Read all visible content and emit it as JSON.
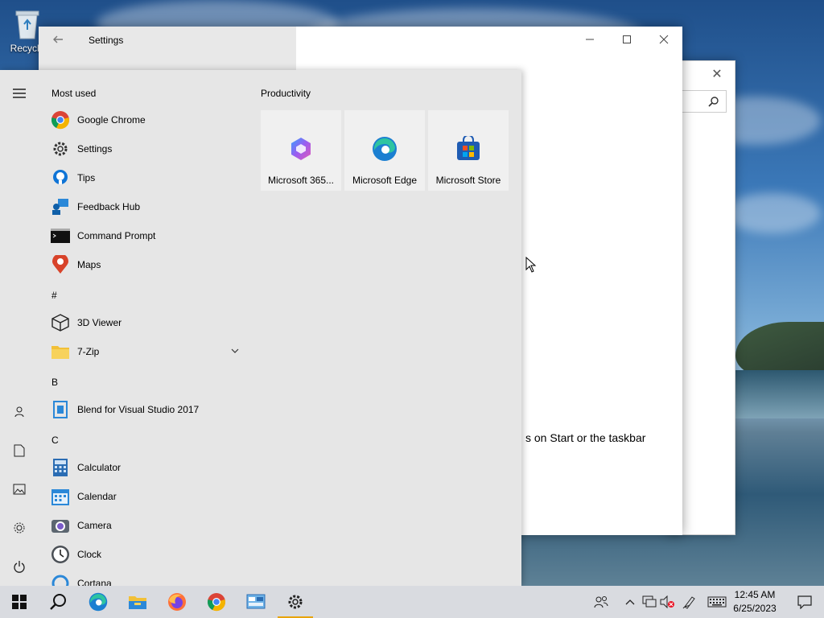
{
  "desktop": {
    "recycle_bin_label": "Recycle"
  },
  "back_window": {
    "close_icon": "close-icon",
    "search_icon": "search-icon"
  },
  "settings_window": {
    "title": "Settings",
    "partial_text": "s on Start or the taskbar",
    "controls": [
      "minimize",
      "maximize",
      "close"
    ]
  },
  "start_menu": {
    "rail": [
      "menu",
      "user",
      "documents",
      "pictures",
      "settings",
      "power"
    ],
    "most_used_header": "Most used",
    "most_used": [
      {
        "label": "Google Chrome",
        "icon": "chrome-icon"
      },
      {
        "label": "Settings",
        "icon": "gear-icon"
      },
      {
        "label": "Tips",
        "icon": "lightbulb-icon"
      },
      {
        "label": "Feedback Hub",
        "icon": "feedback-icon"
      },
      {
        "label": "Command Prompt",
        "icon": "terminal-icon"
      },
      {
        "label": "Maps",
        "icon": "map-pin-icon"
      }
    ],
    "section_hash": "#",
    "hash_apps": [
      {
        "label": "3D Viewer",
        "icon": "cube-icon"
      },
      {
        "label": "7-Zip",
        "icon": "folder-icon"
      }
    ],
    "section_b": "B",
    "b_apps": [
      {
        "label": "Blend for Visual Studio 2017",
        "icon": "blend-icon"
      }
    ],
    "section_c": "C",
    "c_apps": [
      {
        "label": "Calculator",
        "icon": "calculator-icon"
      },
      {
        "label": "Calendar",
        "icon": "calendar-icon"
      },
      {
        "label": "Camera",
        "icon": "camera-icon"
      },
      {
        "label": "Clock",
        "icon": "clock-icon"
      },
      {
        "label": "Cortana",
        "icon": "cortana-icon"
      }
    ],
    "tiles_group": "Productivity",
    "tiles": [
      {
        "label": "Microsoft 365...",
        "icon": "m365-icon"
      },
      {
        "label": "Microsoft Edge",
        "icon": "edge-icon"
      },
      {
        "label": "Microsoft Store",
        "icon": "store-icon"
      }
    ]
  },
  "taskbar": {
    "pinned": [
      "start-icon",
      "search-icon",
      "edge-icon",
      "file-explorer-icon",
      "firefox-icon",
      "chrome-icon",
      "control-panel-icon",
      "settings-icon"
    ],
    "active_index": 7,
    "tray": [
      "people-icon",
      "chevron-up-icon",
      "network-icon",
      "volume-muted-icon",
      "pen-icon",
      "keyboard-icon"
    ],
    "time": "12:45 AM",
    "date": "6/25/2023",
    "accent": "#e8a40c"
  }
}
